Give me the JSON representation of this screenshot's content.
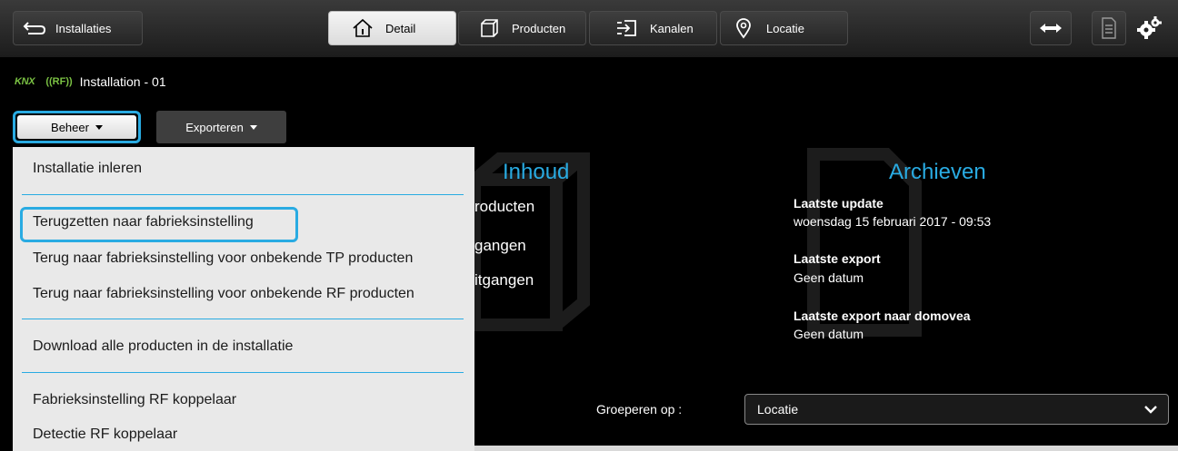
{
  "nav": {
    "back_label": "Installaties",
    "tabs": [
      {
        "label": "Detail",
        "icon": "home-icon",
        "active": true
      },
      {
        "label": "Producten",
        "icon": "box-icon",
        "active": false
      },
      {
        "label": "Kanalen",
        "icon": "channel-icon",
        "active": false
      },
      {
        "label": "Locatie",
        "icon": "location-pin-icon",
        "active": false
      }
    ],
    "right_icons": [
      "link-arrows-icon",
      "document-icon",
      "gears-icon"
    ]
  },
  "installation": {
    "knx": "KNX",
    "rf": "((RF))",
    "title": "Installation - 01"
  },
  "buttons": {
    "beheer": "Beheer",
    "exporteren": "Exporteren"
  },
  "dropdown": {
    "items": [
      "Installatie inleren",
      "Terugzetten naar fabrieksinstelling",
      "Terug naar fabrieksinstelling voor onbekende TP producten",
      "Terug naar fabrieksinstelling voor onbekende RF producten",
      "Download alle producten in de installatie",
      "Fabrieksinstelling RF koppelaar",
      "Detectie RF koppelaar"
    ]
  },
  "inhoud": {
    "title": "Inhoud",
    "items": [
      "roducten",
      "gangen",
      "itgangen"
    ]
  },
  "archieven": {
    "title": "Archieven",
    "entries": [
      {
        "label": "Laatste update",
        "value": "woensdag 15 februari 2017 - 09:53"
      },
      {
        "label": "Laatste export",
        "value": "Geen datum"
      },
      {
        "label": "Laatste export naar domovea",
        "value": "Geen datum"
      }
    ]
  },
  "group_by": {
    "label": "Groeperen op :",
    "selected": "Locatie"
  },
  "colors": {
    "accent": "#29abe2",
    "knx_green": "#7ac143"
  }
}
